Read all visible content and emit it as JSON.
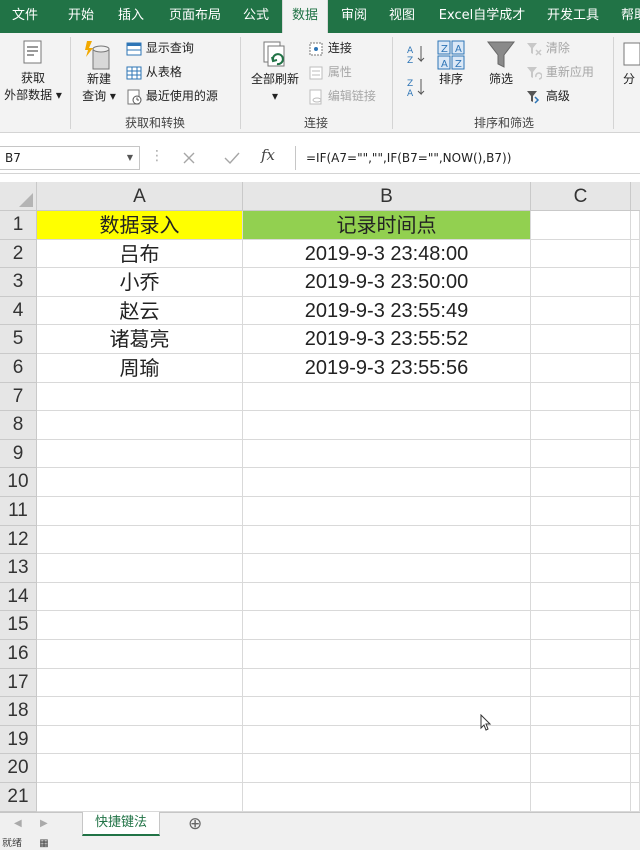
{
  "ribbon": {
    "tabs": [
      "文件",
      "开始",
      "插入",
      "页面布局",
      "公式",
      "数据",
      "审阅",
      "视图",
      "Excel自学成才",
      "开发工具",
      "帮助"
    ],
    "active_tab": "数据",
    "get_transform": {
      "get_external_data": "获取\n外部数据",
      "new_query": "新建\n查询",
      "show_queries": "显示查询",
      "from_table": "从表格",
      "recent_sources": "最近使用的源",
      "group_label": "获取和转换"
    },
    "connections": {
      "refresh_all": "全部刷新",
      "connections": "连接",
      "properties": "属性",
      "edit_links": "编辑链接",
      "group_label": "连接"
    },
    "sort_filter": {
      "sort": "排序",
      "filter": "筛选",
      "clear": "清除",
      "reapply": "重新应用",
      "advanced": "高级",
      "group_label": "排序和筛选"
    },
    "cut_off_label": "分"
  },
  "formula_bar": {
    "name_box": "B7",
    "formula": "=IF(A7=\"\",\"\",IF(B7=\"\",NOW(),B7))"
  },
  "sheet": {
    "columns": [
      "A",
      "B",
      "C"
    ],
    "row_numbers": [
      "1",
      "2",
      "3",
      "4",
      "5",
      "6",
      "7",
      "8",
      "9",
      "10",
      "11",
      "12",
      "13",
      "14",
      "15",
      "16",
      "17",
      "18",
      "19",
      "20",
      "21"
    ],
    "header_a": "数据录入",
    "header_b": "记录时间点",
    "rows": [
      {
        "a": "吕布",
        "b": "2019-9-3 23:48:00"
      },
      {
        "a": "小乔",
        "b": "2019-9-3 23:50:00"
      },
      {
        "a": "赵云",
        "b": "2019-9-3 23:55:49"
      },
      {
        "a": "诸葛亮",
        "b": "2019-9-3 23:55:52"
      },
      {
        "a": "周瑜",
        "b": "2019-9-3 23:55:56"
      }
    ],
    "header_a_color": "#ffff00",
    "header_b_color": "#92d050"
  },
  "sheet_tabs": {
    "tabs": [
      "快捷键法"
    ],
    "add_sheet": "⊕"
  },
  "status": {
    "text": "就绪"
  },
  "colors": {
    "brand_green": "#217346"
  }
}
